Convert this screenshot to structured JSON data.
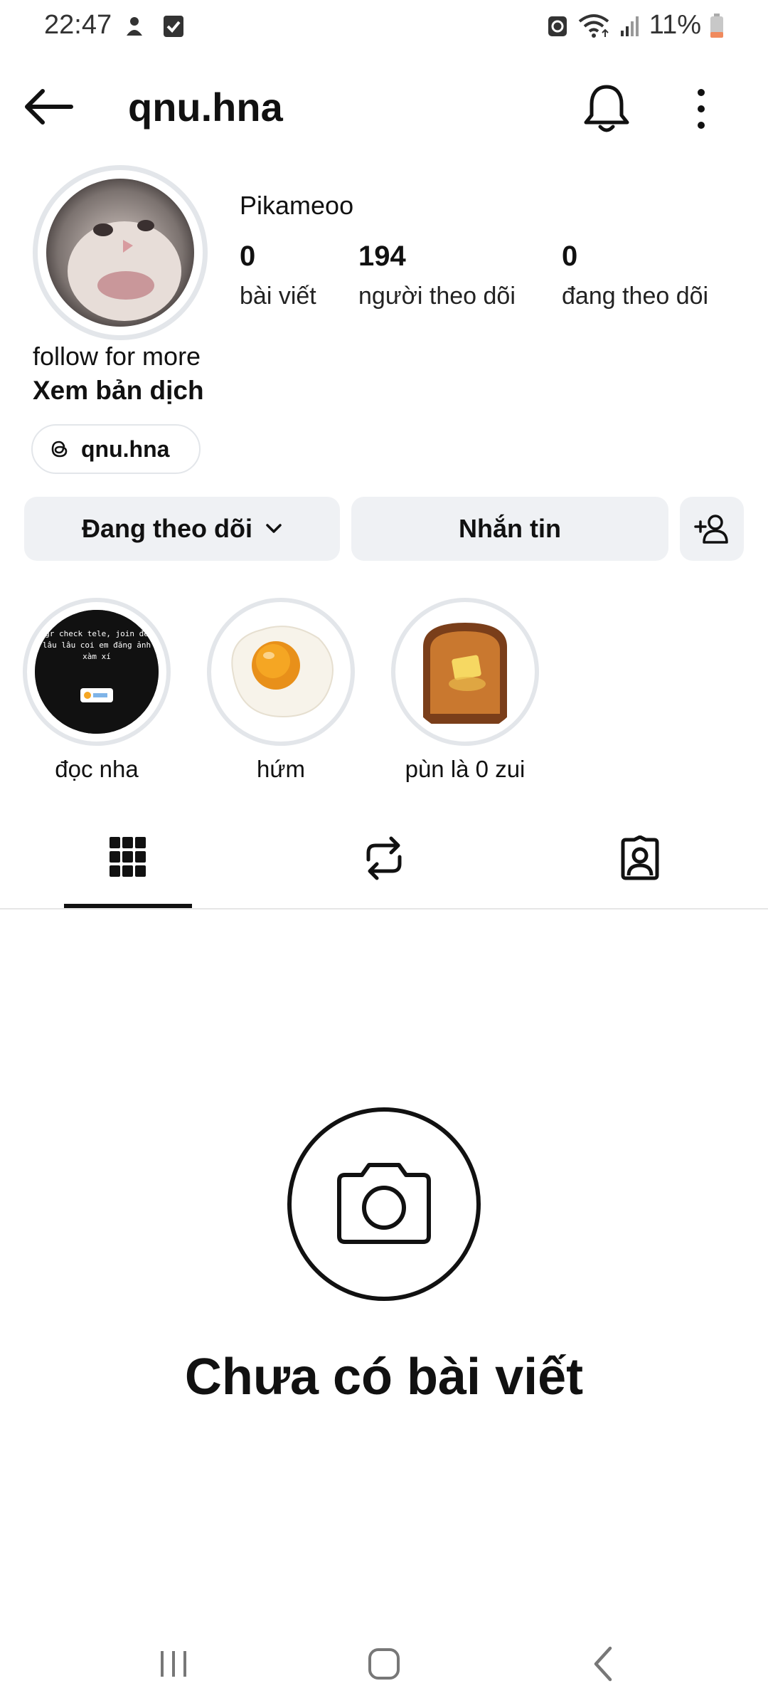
{
  "status_bar": {
    "time": "22:47",
    "battery": "11%",
    "icons": [
      "notification-icon",
      "checkbox-icon",
      "recycle-icon",
      "wifi-icon",
      "signal-icon",
      "battery-icon"
    ]
  },
  "header": {
    "username": "qnu.hna",
    "icons": [
      "back-arrow-icon",
      "bell-icon",
      "more-vertical-icon"
    ]
  },
  "profile": {
    "display_name": "Pikameoo",
    "stats": [
      {
        "value": "0",
        "label": "bài viết"
      },
      {
        "value": "194",
        "label": "người theo dõi"
      },
      {
        "value": "0",
        "label": "đang theo dõi"
      }
    ],
    "bio": "follow for more",
    "translate_link": "Xem bản dịch",
    "threads_handle": "qnu.hna"
  },
  "actions": {
    "following_label": "Đang theo dõi",
    "message_label": "Nhắn tin"
  },
  "highlights": [
    {
      "label": "đọc nha",
      "thumb_text": "gr check tele, join để lâu lâu coi em đăng ảnh xàm xí"
    },
    {
      "label": "hứm"
    },
    {
      "label": "pùn là 0 zui"
    }
  ],
  "tabs": [
    "grid-icon",
    "reposts-icon",
    "tagged-icon"
  ],
  "empty_state": {
    "message": "Chưa có bài viết"
  },
  "colors": {
    "button_bg": "#eff1f4",
    "ring": "#e3e6ea",
    "text": "#111111"
  }
}
